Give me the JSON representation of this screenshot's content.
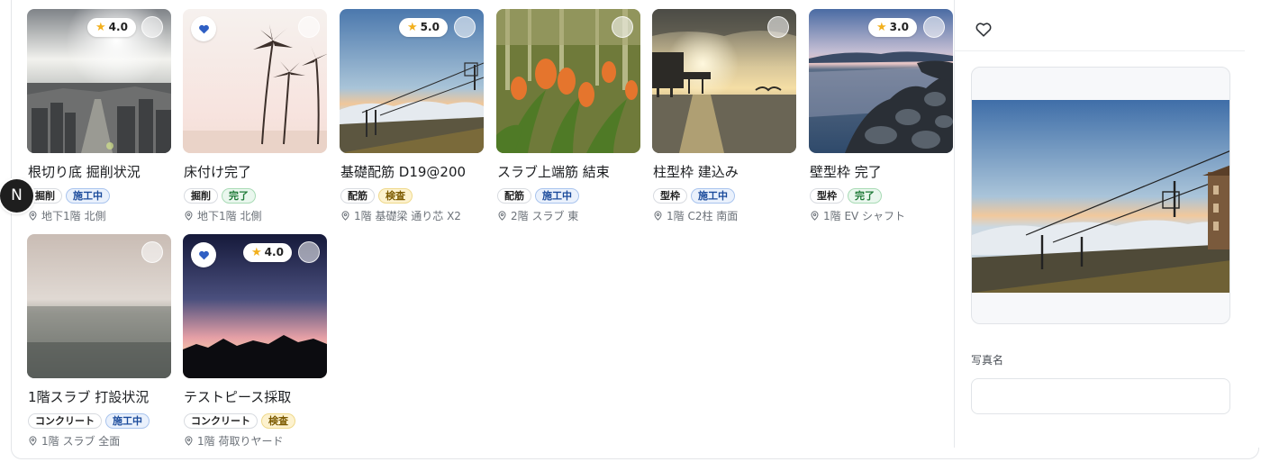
{
  "user": {
    "avatar_initial": "N"
  },
  "rating_icon": "star-icon",
  "photos": [
    {
      "title": "根切り底 掘削状況",
      "category": "掘削",
      "status": "施工中",
      "location": "地下1階 北側",
      "rating": "4.0",
      "favorite": false
    },
    {
      "title": "床付け完了",
      "category": "掘削",
      "status": "完了",
      "location": "地下1階 北側",
      "rating": "",
      "favorite": true
    },
    {
      "title": "基礎配筋 D19@200",
      "category": "配筋",
      "status": "検査",
      "location": "1階 基礎梁 通り芯 X2",
      "rating": "5.0",
      "favorite": false
    },
    {
      "title": "スラブ上端筋 結束",
      "category": "配筋",
      "status": "施工中",
      "location": "2階 スラブ 東",
      "rating": "",
      "favorite": false
    },
    {
      "title": "柱型枠 建込み",
      "category": "型枠",
      "status": "施工中",
      "location": "1階 C2柱 南面",
      "rating": "",
      "favorite": false
    },
    {
      "title": "壁型枠 完了",
      "category": "型枠",
      "status": "完了",
      "location": "1階 EV シャフト",
      "rating": "3.0",
      "favorite": false
    },
    {
      "title": "1階スラブ 打設状況",
      "category": "コンクリート",
      "status": "施工中",
      "location": "1階 スラブ 全面",
      "rating": "",
      "favorite": false
    },
    {
      "title": "テストピース採取",
      "category": "コンクリート",
      "status": "検査",
      "location": "1階 荷取りヤード",
      "rating": "4.0",
      "favorite": true
    }
  ],
  "detail_panel": {
    "favorite_icon": "heart-outline-icon",
    "field_label": "写真名",
    "field_value": ""
  },
  "colors": {
    "status_in_progress": "#1a4a9b",
    "status_done": "#1f7a38",
    "status_inspection": "#7d5b00",
    "favorite": "#2f5fc4",
    "star": "#f2b01e"
  }
}
